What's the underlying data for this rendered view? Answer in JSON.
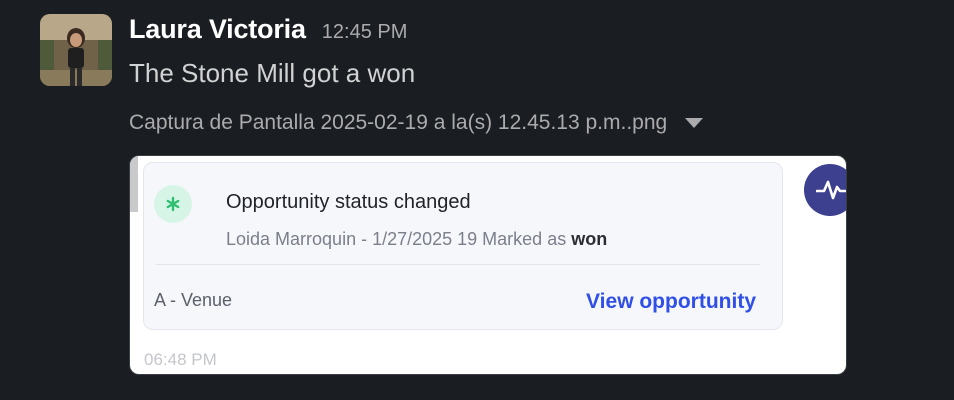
{
  "message": {
    "sender": "Laura Victoria",
    "time": "12:45 PM",
    "text": "The Stone Mill got a won"
  },
  "attachment": {
    "file_name": "Captura de Pantalla 2025-02-19 a la(s) 12.45.13 p.m..png",
    "menu_icon": "chevron-down-icon"
  },
  "preview": {
    "title": "Opportunity status changed",
    "detail_prefix": "Loida Marroquin - 1/27/2025 19 Marked as",
    "detail_status": "won",
    "venue": "A - Venue",
    "link": "View opportunity",
    "footer_time": "06:48 PM",
    "status_icon": "asterisk-icon",
    "badge_icon": "activity-icon"
  },
  "colors": {
    "background": "#1a1d21",
    "link": "#2f4fe6",
    "status_icon_bg": "#d7f5e6",
    "badge_bg": "#3d3f8f"
  }
}
